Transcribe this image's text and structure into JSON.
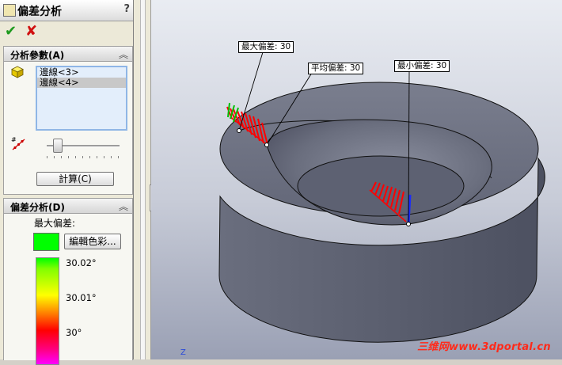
{
  "panel": {
    "title": "偏差分析",
    "help": "?",
    "ok_icon": "✔",
    "cancel_icon": "✘"
  },
  "params": {
    "header": "分析參數(A)",
    "edges": [
      "邊線<3>",
      "邊線<4>"
    ],
    "selected_index": 1,
    "slider_level": 0.1,
    "calc_button": "計算(C)"
  },
  "deviation": {
    "header": "偏差分析(D)",
    "max_label": "最大偏差:",
    "swatch_color": "#00ff00",
    "edit_color_button": "編輯色彩...",
    "scale_labels": [
      "30.02°",
      "30.01°",
      "30°"
    ]
  },
  "viewport": {
    "callouts": {
      "max": "最大偏差: 30",
      "avg": "平均偏差: 30",
      "min": "最小偏差: 30"
    },
    "axis_label": "Z",
    "watermark": "三维网www.3dportal.cn",
    "model_color": "#5f6373",
    "comb_color": "#ff0000"
  },
  "icons": {
    "panel": "deviation-analysis-icon",
    "cube": "cube-icon",
    "slider": "resolution-icon",
    "collapse": "chevron-up-double-icon"
  }
}
